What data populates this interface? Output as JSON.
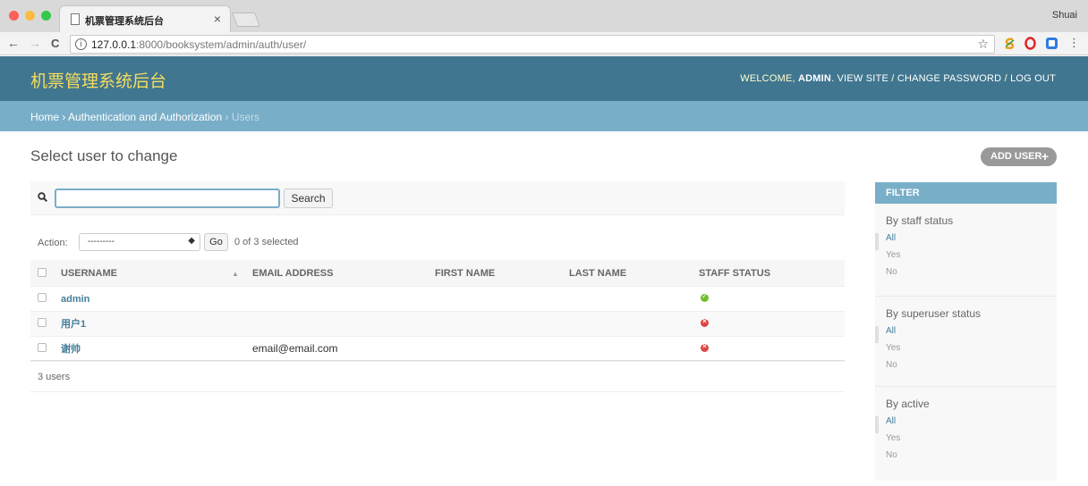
{
  "browser": {
    "tab_title": "机票管理系统后台",
    "tab_close": "×",
    "profile_name": "Shuai",
    "url_host": "127.0.0.1",
    "url_path": ":8000/booksystem/admin/auth/user/",
    "back_icon": "←",
    "forward_icon": "→",
    "reload_icon": "C",
    "star_icon": "☆",
    "menu_icon": "⋮",
    "info_icon": "i"
  },
  "header": {
    "brand": "机票管理系统后台",
    "welcome": "WELCOME,",
    "username": "ADMIN",
    "view_site": "VIEW SITE",
    "change_password": "CHANGE PASSWORD",
    "logout": "LOG OUT",
    "sep": "/"
  },
  "breadcrumbs": {
    "home": "Home",
    "section": "Authentication and Authorization",
    "current": "Users",
    "sep": "›"
  },
  "main": {
    "title": "Select user to change",
    "add_button": "ADD USER",
    "add_icon": "+"
  },
  "search": {
    "value": "",
    "button": "Search"
  },
  "actions": {
    "label": "Action:",
    "selected_option": "---------",
    "arrow": "◆",
    "go": "Go",
    "count": "0 of 3 selected"
  },
  "table": {
    "columns": [
      "USERNAME",
      "EMAIL ADDRESS",
      "FIRST NAME",
      "LAST NAME",
      "STAFF STATUS"
    ],
    "sort_indicator": "▲",
    "rows": [
      {
        "username": "admin",
        "email": "",
        "first": "",
        "last": "",
        "staff": true,
        "staff_glyph": "✓"
      },
      {
        "username": "用户1",
        "email": "",
        "first": "",
        "last": "",
        "staff": false,
        "staff_glyph": "×"
      },
      {
        "username": "谢帅",
        "email": "email@email.com",
        "first": "",
        "last": "",
        "staff": false,
        "staff_glyph": "×"
      }
    ]
  },
  "paginator": {
    "text": "3 users"
  },
  "filter": {
    "title": "FILTER",
    "groups": [
      {
        "title": "By staff status",
        "options": [
          "All",
          "Yes",
          "No"
        ],
        "selected": 0
      },
      {
        "title": "By superuser status",
        "options": [
          "All",
          "Yes",
          "No"
        ],
        "selected": 0
      },
      {
        "title": "By active",
        "options": [
          "All",
          "Yes",
          "No"
        ],
        "selected": 0
      }
    ]
  },
  "colors": {
    "header_bg": "#417690",
    "breadcrumb_bg": "#79aec8",
    "brand_text": "#f5dd5d",
    "link": "#447e9b",
    "yes_icon": "#70bf2b",
    "no_icon": "#dd4646"
  }
}
